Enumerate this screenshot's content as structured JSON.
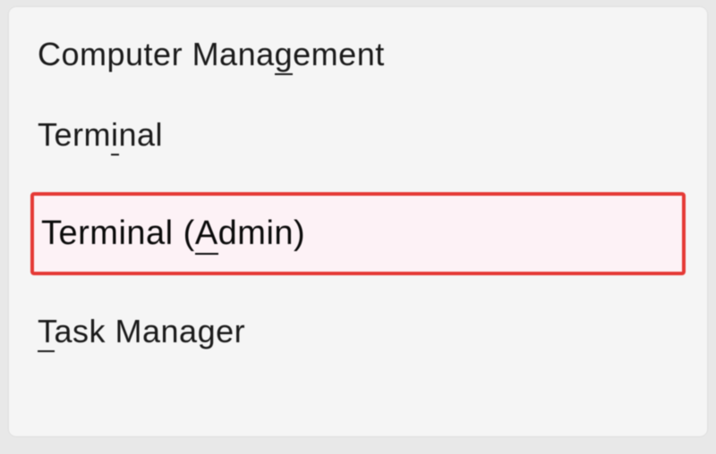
{
  "menu": {
    "items": [
      {
        "label": "Computer Management",
        "accesskey": "g",
        "highlighted": false
      },
      {
        "label": "Terminal",
        "accesskey": "i",
        "highlighted": false
      },
      {
        "label": "Terminal (Admin)",
        "accesskey": "A",
        "highlighted": true
      },
      {
        "label": "Task Manager",
        "accesskey": "T",
        "highlighted": false
      }
    ]
  }
}
